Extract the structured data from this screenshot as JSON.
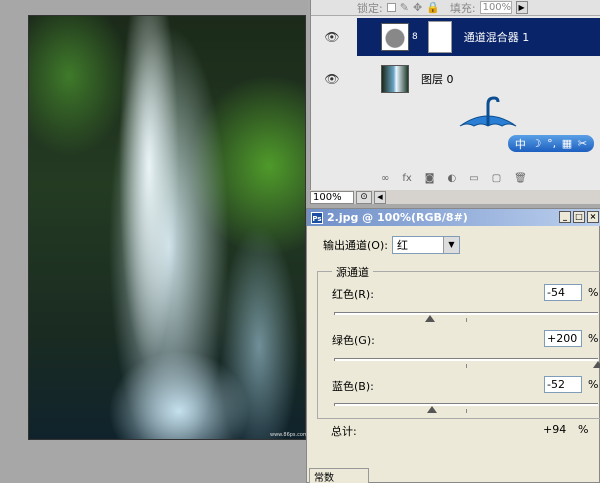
{
  "layers": {
    "lock_label": "锁定:",
    "fill_label": "填充:",
    "fill_value": "100%",
    "items": [
      {
        "name": "通道混合器 1",
        "selected": true
      },
      {
        "name": "图层 0",
        "selected": false
      }
    ],
    "toolbar_icons": [
      "link-icon",
      "fx-icon",
      "mask-icon",
      "adjustment-icon",
      "folder-icon",
      "new-layer-icon",
      "trash-icon"
    ],
    "fx_label": "fx"
  },
  "zoom": {
    "value": "100%"
  },
  "ime": {
    "label": "中"
  },
  "mixer": {
    "title": "2.jpg @ 100%(RGB/8#)",
    "output_label": "输出通道(O):",
    "output_value": "红",
    "source_label": "源通道",
    "channels": [
      {
        "label": "红色(R):",
        "value": "-54",
        "pct": "%",
        "level": -54
      },
      {
        "label": "绿色(G):",
        "value": "+200",
        "pct": "%",
        "level": 200
      },
      {
        "label": "蓝色(B):",
        "value": "-52",
        "pct": "%",
        "level": -52
      }
    ],
    "total_label": "总计:",
    "total_value": "+94",
    "total_pct": "%",
    "constant_label": "常数"
  },
  "credit": "www.86ps.com"
}
